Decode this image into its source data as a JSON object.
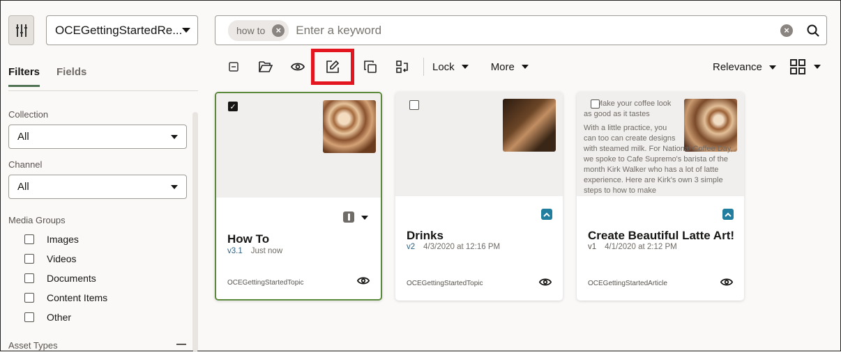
{
  "repository": {
    "selected": "OCEGettingStartedRe..."
  },
  "search": {
    "chip": "how to",
    "placeholder": "Enter a keyword"
  },
  "sidebar": {
    "tabs": [
      {
        "label": "Filters",
        "active": true
      },
      {
        "label": "Fields",
        "active": false
      }
    ],
    "collection": {
      "label": "Collection",
      "value": "All"
    },
    "channel": {
      "label": "Channel",
      "value": "All"
    },
    "media_groups": {
      "label": "Media Groups",
      "items": [
        "Images",
        "Videos",
        "Documents",
        "Content Items",
        "Other"
      ]
    },
    "asset_types": {
      "label": "Asset Types"
    }
  },
  "toolbar": {
    "lock": "Lock",
    "more": "More",
    "sort": "Relevance",
    "highlight_color": "#e3161f"
  },
  "cards": [
    {
      "title": "How To",
      "version": "v3.1",
      "date": "Just now",
      "type": "OCEGettingStartedTopic",
      "checked": true,
      "status": "in-progress"
    },
    {
      "title": "Drinks",
      "version": "v2",
      "date": "4/3/2020 at 12:16 PM",
      "type": "OCEGettingStartedTopic",
      "checked": false,
      "status": "published"
    },
    {
      "title": "Create Beautiful Latte Art!",
      "version": "v1",
      "date": "4/1/2020 at 2:12 PM",
      "type": "OCEGettingStartedArticle",
      "checked": false,
      "status": "published",
      "preview_heading": "Make your coffee look as good as it tastes",
      "preview_body": "With a little practice, you can too can create designs with steamed milk.  For National Coffee Day, we spoke to Cafe Supremo's barista of the month Kirk Walker who has a lot of latte experience.  Here are Kirk's own 3 simple steps to how to make"
    }
  ]
}
